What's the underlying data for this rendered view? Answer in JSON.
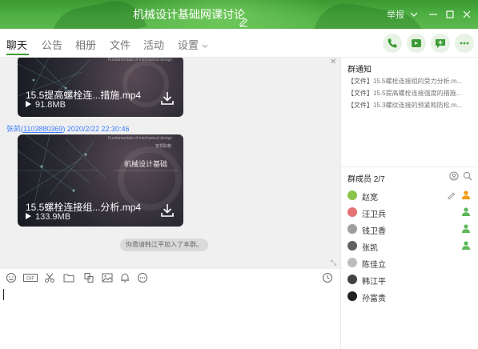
{
  "window": {
    "title": "机械设计基础网课讨论",
    "report_label": "举报"
  },
  "tabs": [
    {
      "label": "聊天"
    },
    {
      "label": "公告"
    },
    {
      "label": "相册"
    },
    {
      "label": "文件"
    },
    {
      "label": "活动"
    },
    {
      "label": "设置"
    }
  ],
  "messages": {
    "file1": {
      "name": "15.5提高螺栓连...措施.mp4",
      "size": "91.8MB",
      "header_text": "Fundamentals of mechanical design"
    },
    "sender": {
      "name": "张凯",
      "id": "1103880369",
      "time": "2020/2/22 22:30:46"
    },
    "file2": {
      "name": "15.5螺栓连接组...分析.mp4",
      "size": "133.9MB",
      "center_title": "机械设计基础",
      "brand": "智慧职教",
      "header_text": "Fundamentals of mechanical design"
    },
    "system": "你邀请韩江平加入了本群。"
  },
  "notice": {
    "title": "群通知",
    "items": [
      {
        "tag": "【文件】",
        "text": "15.5螺栓连接组的受力分析.m..."
      },
      {
        "tag": "【文件】",
        "text": "15.5提高螺栓连接强度的措施..."
      },
      {
        "tag": "【文件】",
        "text": "15.3螺纹连接的预紧和防松.m..."
      }
    ]
  },
  "members": {
    "title": "群成员 2/7",
    "list": [
      {
        "name": "赵宽",
        "avatar_color": "#8bc34a",
        "role": "owner",
        "editable": true
      },
      {
        "name": "汪卫兵",
        "avatar_color": "#e57373",
        "role": "admin",
        "editable": false
      },
      {
        "name": "钱卫香",
        "avatar_color": "#9e9e9e",
        "role": "admin",
        "editable": false
      },
      {
        "name": "张凯",
        "avatar_color": "#616161",
        "role": "admin",
        "editable": false
      },
      {
        "name": "陈佳立",
        "avatar_color": "#bdbdbd",
        "role": "",
        "editable": false
      },
      {
        "name": "韩江平",
        "avatar_color": "#424242",
        "role": "",
        "editable": false
      },
      {
        "name": "孙富贵",
        "avatar_color": "#212121",
        "role": "",
        "editable": false
      }
    ]
  },
  "colors": {
    "accent": "#3d9c35",
    "link": "#3a7cff",
    "owner": "#f39c12",
    "admin": "#5fb85a"
  },
  "icons": [
    "phone-icon",
    "video-call-icon",
    "add-chat-icon",
    "more-icon",
    "emoji-icon",
    "gif-icon",
    "scissors-icon",
    "folder-icon",
    "doc-icon",
    "image-icon",
    "bell-icon",
    "more-circle-icon",
    "history-icon",
    "download-icon",
    "search-icon",
    "invite-icon",
    "edit-icon"
  ]
}
